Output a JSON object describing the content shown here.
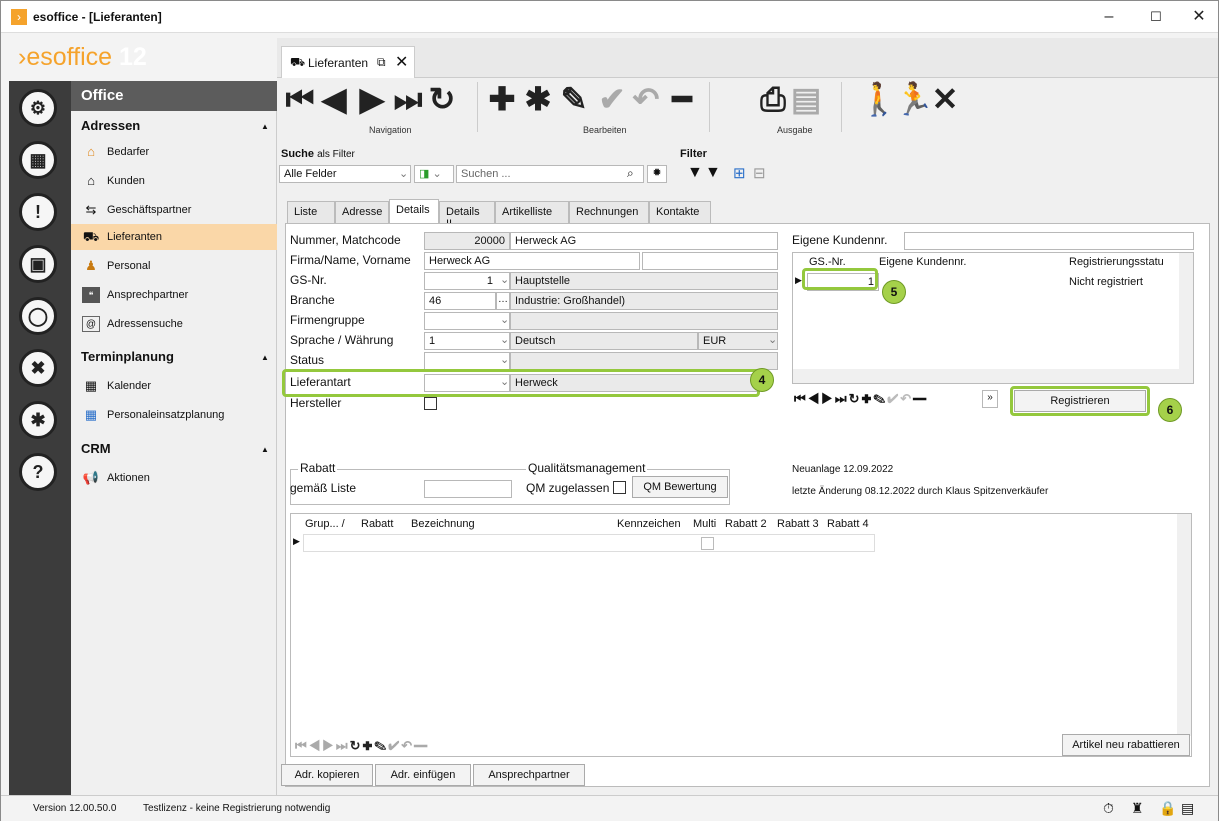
{
  "window": {
    "title": "esoffice - [Lieferanten]",
    "minimize": "–",
    "maximize": "☐",
    "close": "✕"
  },
  "app": {
    "logo_prefix": "es",
    "logo_main": "office",
    "logo_version": "12"
  },
  "sidebar": {
    "header": "Office",
    "categories": [
      {
        "label": "Adressen"
      },
      {
        "label": "Terminplanung"
      },
      {
        "label": "CRM"
      }
    ],
    "items": [
      {
        "label": "Bedarfer",
        "icon": "house-icon"
      },
      {
        "label": "Kunden",
        "icon": "house-icon"
      },
      {
        "label": "Geschäftspartner",
        "icon": "handshake-icon"
      },
      {
        "label": "Lieferanten",
        "icon": "delivery-truck-icon"
      },
      {
        "label": "Personal",
        "icon": "people-icon"
      },
      {
        "label": "Ansprechpartner",
        "icon": "contact-card-icon"
      },
      {
        "label": "Adressensuche",
        "icon": "search-address-icon"
      },
      {
        "label": "Kalender",
        "icon": "calendar-icon"
      },
      {
        "label": "Personaleinsatzplanung",
        "icon": "staff-planning-icon"
      },
      {
        "label": "Aktionen",
        "icon": "megaphone-icon"
      }
    ]
  },
  "doc_tab": {
    "label": "Lieferanten"
  },
  "toolbar": {
    "nav_label": "Navigation",
    "edit_label": "Bearbeiten",
    "output_label": "Ausgabe"
  },
  "search": {
    "label": "Suche",
    "sublabel": "als Filter",
    "field_select": "Alle Felder",
    "placeholder": "Suchen ...",
    "filter_label": "Filter"
  },
  "tabs": [
    "Liste",
    "Adresse",
    "Details",
    "Details II",
    "Artikelliste",
    "Rechnungen",
    "Kontakte"
  ],
  "form": {
    "labels": {
      "nummer": "Nummer, Matchcode",
      "firma": "Firma/Name, Vorname",
      "gs": "GS-Nr.",
      "branche": "Branche",
      "firmengruppe": "Firmengruppe",
      "sprache": "Sprache / Währung",
      "status": "Status",
      "lieferantart": "Lieferantart",
      "hersteller": "Hersteller"
    },
    "values": {
      "nummer": "20000",
      "matchcode": "Herweck AG",
      "firma": "Herweck AG",
      "gs_nr": "1",
      "gs_name": "Hauptstelle",
      "branche_nr": "46",
      "branche_name": "Industrie: Großhandel)",
      "sprache_nr": "1",
      "sprache_name": "Deutsch",
      "waehrung": "EUR",
      "lieferantart": "Herweck"
    }
  },
  "kunden": {
    "label": "Eigene Kundennr.",
    "col_gs": "GS.-Nr.",
    "col_nr": "Eigene Kundennr.",
    "col_reg": "Registrierungsstatu",
    "row_gs": "1",
    "row_reg": "Nicht registriert",
    "register_button": "Registrieren"
  },
  "rabatt": {
    "group_label": "Rabatt",
    "gemaess": "gemäß Liste",
    "qm_label": "Qualitätsmanagement",
    "qm_zugelassen": "QM zugelassen",
    "qm_button": "QM Bewertung"
  },
  "meta": {
    "neuanlage": "Neuanlage 12.09.2022",
    "aenderung_prefix": "letzte Änderung",
    "aenderung_date": "08.12.2022",
    "aenderung_by": "durch Klaus Spitzenverkäufer"
  },
  "grid": {
    "columns": [
      "Grup... /",
      "Rabatt",
      "Bezeichnung",
      "Kennzeichen",
      "Multi",
      "Rabatt 2",
      "Rabatt 3",
      "Rabatt 4"
    ],
    "rebate_button": "Artikel neu rabattieren"
  },
  "bottom_buttons": [
    "Adr. kopieren",
    "Adr. einfügen",
    "Ansprechpartner"
  ],
  "badges": [
    "4",
    "5",
    "6"
  ],
  "status": {
    "version": "Version 12.00.50.0",
    "license": "Testlizenz - keine Registrierung notwendig"
  },
  "colors": {
    "highlight": "#94c83d",
    "active_item": "#fad7a8",
    "rail": "#3c3c3c"
  }
}
